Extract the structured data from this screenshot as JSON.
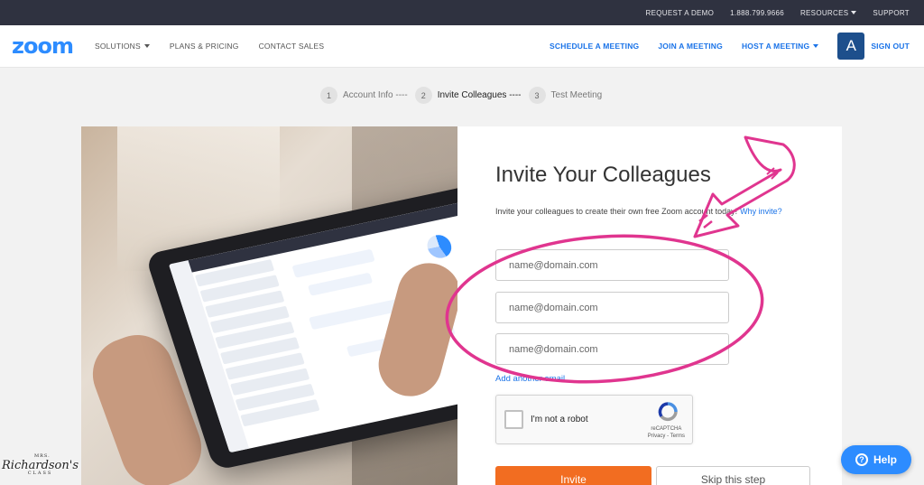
{
  "topbar": {
    "items": [
      "REQUEST A DEMO",
      "1.888.799.9666",
      "RESOURCES",
      "SUPPORT"
    ]
  },
  "nav": {
    "logo": "zoom",
    "left": [
      "SOLUTIONS",
      "PLANS & PRICING",
      "CONTACT SALES"
    ],
    "right": [
      "SCHEDULE A MEETING",
      "JOIN A MEETING",
      "HOST A MEETING"
    ],
    "avatar": "A",
    "signout": "SIGN OUT"
  },
  "steps": [
    {
      "num": "1",
      "label": "Account Info ----"
    },
    {
      "num": "2",
      "label": "Invite Colleagues ----"
    },
    {
      "num": "3",
      "label": "Test Meeting"
    }
  ],
  "form": {
    "title": "Invite Your Colleagues",
    "subtitle": "Invite your colleagues to create their own free Zoom account today!",
    "why_link": "Why invite?",
    "email_placeholder": "name@domain.com",
    "add_link": "Add another email",
    "captcha_label": "I'm not a robot",
    "captcha_brand": "reCAPTCHA",
    "captcha_terms": "Privacy - Terms",
    "invite_button": "Invite",
    "skip_button": "Skip this step"
  },
  "help_button": "Help",
  "watermark": {
    "top": "MRS.",
    "name": "Richardson's",
    "bottom": "CLASS"
  },
  "colors": {
    "accent": "#2d8cff",
    "orange": "#f26d21",
    "annotation": "#e0358f",
    "topbar": "#2f3240"
  }
}
